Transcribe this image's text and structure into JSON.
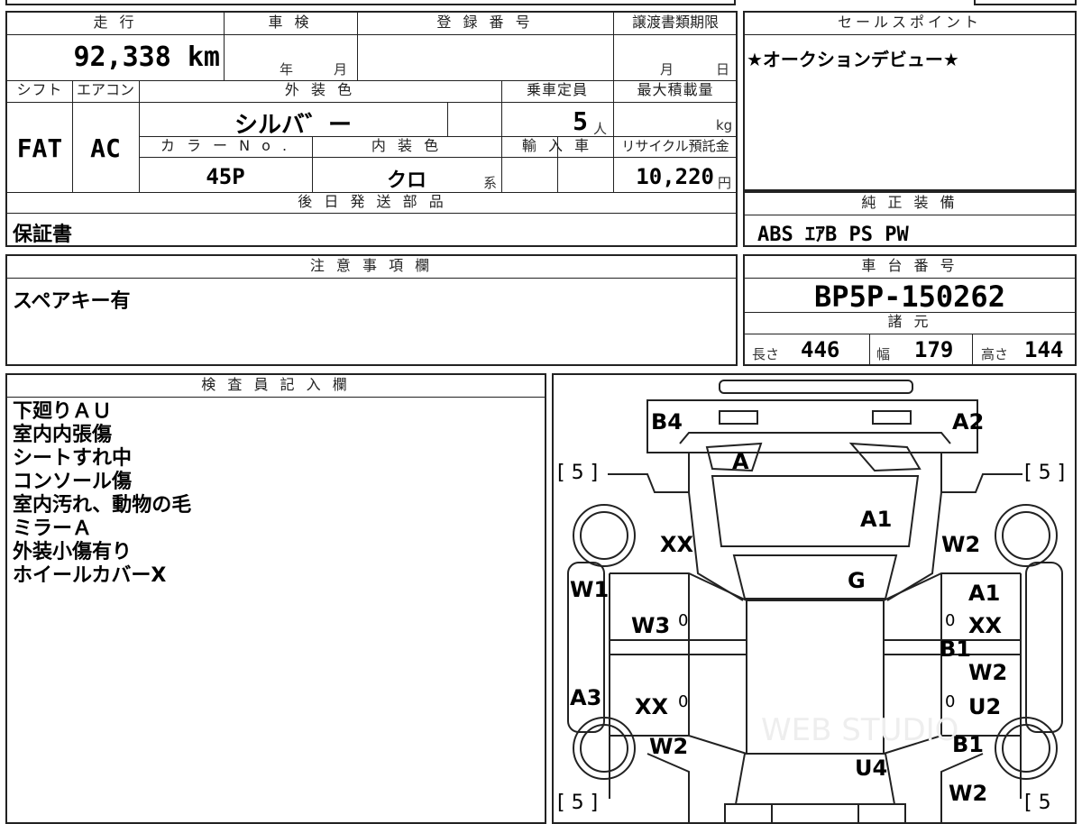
{
  "top_table": {
    "h_mileage": "走 行",
    "h_inspection": "車 検",
    "h_registration": "登 録 番 号",
    "h_transfer": "譲渡書類期限",
    "mileage": "92,338 km",
    "insp_year": "年",
    "insp_month": "月",
    "transfer_month": "月",
    "transfer_day": "日",
    "h_shift": "シフト",
    "h_ac": "エアコン",
    "h_exterior": "外 装 色",
    "h_capacity": "乗車定員",
    "h_maxload": "最大積載量",
    "shift": "FAT",
    "ac": "AC",
    "exterior_color": "シルバ゛ー",
    "capacity": "5",
    "capacity_unit": "人",
    "load_unit": "kg",
    "h_color_no": "カ ラ ー N o .",
    "h_interior": "内 装 色",
    "h_import": "輸 入 車",
    "h_recycle": "リサイクル預託金",
    "color_no": "45P",
    "interior": "クロ",
    "interior_suffix": "系",
    "recycle": "10,220",
    "recycle_unit": "円",
    "h_later_parts": "後 日 発 送 部 品",
    "later_parts": "保証書"
  },
  "sales_point": {
    "header": "セールスポイント",
    "text": "★オークションデビュー★"
  },
  "genuine_equipment": {
    "header": "純 正 装 備",
    "text": "ABS ｴｱB PS PW"
  },
  "caution": {
    "header": "注 意 事 項 欄",
    "text": "スペアキー有"
  },
  "chassis": {
    "header": "車 台 番 号",
    "number": "BP5P-150262",
    "spec_header": "諸 元",
    "length_label": "長さ",
    "length": "446",
    "width_label": "幅",
    "width": "179",
    "height_label": "高さ",
    "height": "144"
  },
  "inspector": {
    "header": "検 査 員 記 入 欄",
    "lines": [
      "下廻りＡＵ",
      "室内内張傷",
      "シートすれ中",
      "コンソール傷",
      "室内汚れ、動物の毛",
      "ミラーＡ",
      "外装小傷有り",
      "ホイールカバーX"
    ]
  },
  "diagram": {
    "tire_top_left": "[ 5 ]",
    "tire_top_right": "[ 5 ]",
    "tire_bottom_left": "[ 5 ]",
    "tire_bottom_right": "[ 5",
    "marks": {
      "b4": "B4",
      "a2": "A2",
      "a": "A",
      "a1_hood": "A1",
      "xx_left_fender": "XX",
      "w2_right_fender": "W2",
      "g": "G",
      "w1": "W1",
      "a1_right": "A1",
      "w3": "W3",
      "xx_right": "XX",
      "b1_right": "B1",
      "w2_right2": "W2",
      "a3": "A3",
      "xx_left_rear": "XX",
      "u2": "U2",
      "w2_left_rear": "W2",
      "b1_rear": "B1",
      "u4": "U4",
      "w2_bottom": "W2",
      "zero_l1": "0",
      "zero_r1": "0",
      "zero_l2": "0",
      "zero_r2": "0"
    }
  },
  "watermark": "WEB STUDIO"
}
